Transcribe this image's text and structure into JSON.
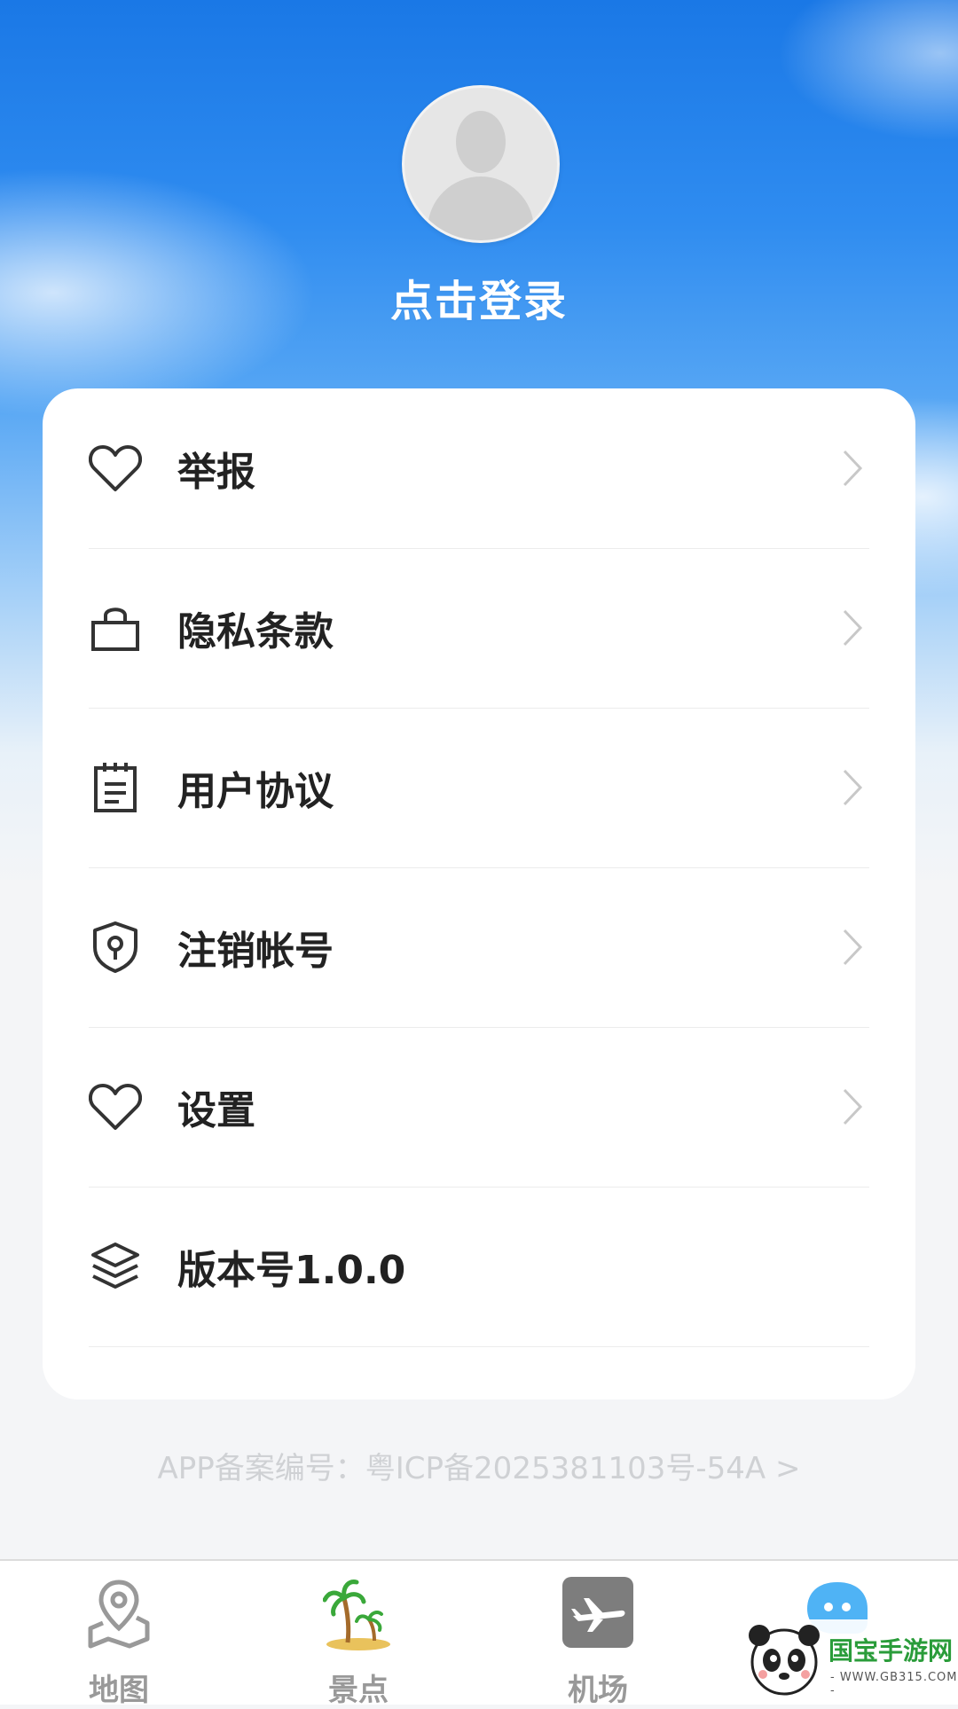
{
  "profile": {
    "login_label": "点击登录"
  },
  "menu": {
    "items": [
      {
        "label": "举报",
        "icon": "heart-icon"
      },
      {
        "label": "隐私条款",
        "icon": "bag-icon"
      },
      {
        "label": "用户协议",
        "icon": "notepad-icon"
      },
      {
        "label": "注销帐号",
        "icon": "shield-icon"
      },
      {
        "label": "设置",
        "icon": "heart-icon"
      },
      {
        "label": "版本号1.0.0",
        "icon": "layers-icon"
      }
    ]
  },
  "footer": {
    "beian": "APP备案编号：粤ICP备2025381103号-54A >"
  },
  "tabbar": {
    "tabs": [
      {
        "label": "地图",
        "icon": "map-pin-icon"
      },
      {
        "label": "景点",
        "icon": "palm-tree-icon"
      },
      {
        "label": "机场",
        "icon": "airplane-icon"
      },
      {
        "label": "",
        "icon": "chat-icon"
      }
    ]
  },
  "watermark": {
    "text": "国宝手游网",
    "url": "- WWW.GB315.COM -"
  },
  "colors": {
    "sky_top": "#1a78e6",
    "card": "#ffffff",
    "text_dark": "#222222",
    "tab_inactive": "#999999",
    "chat_accent": "#4fb3f5"
  }
}
